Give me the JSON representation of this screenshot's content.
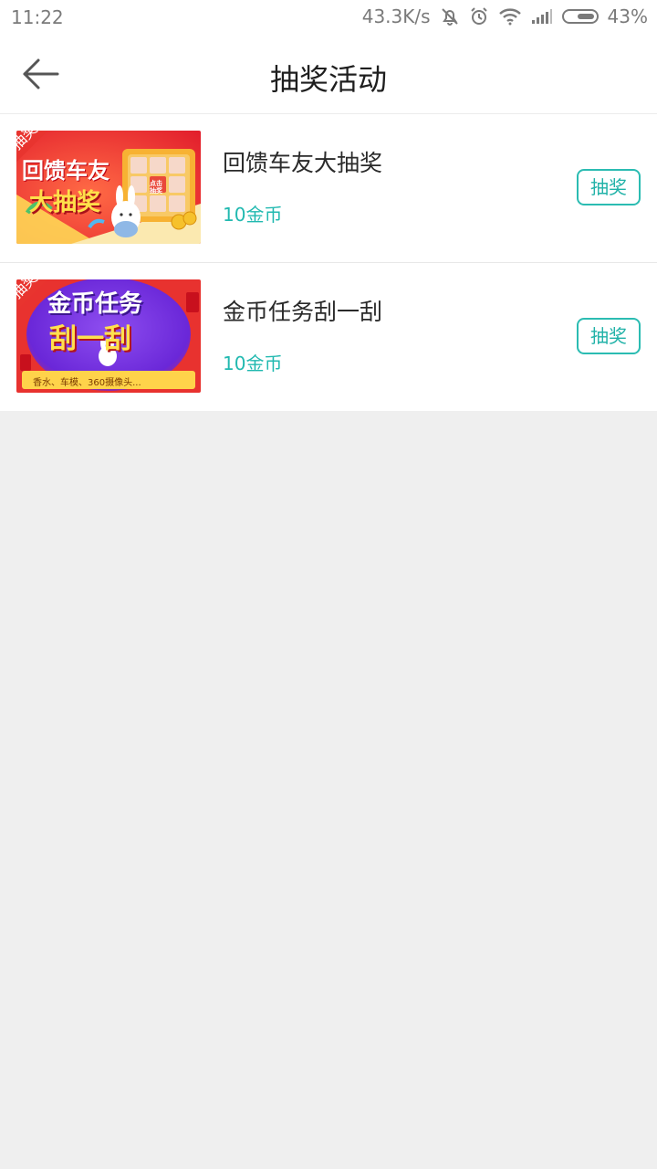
{
  "status": {
    "time": "11:22",
    "speed": "43.3K/s",
    "battery": "43%"
  },
  "header": {
    "title": "抽奖活动",
    "back_icon": "arrow-left-icon"
  },
  "items": [
    {
      "ribbon": "抽奖",
      "name": "回馈车友大抽奖",
      "cost": "10金币",
      "button": "抽奖",
      "banner_line1": "回馈车友",
      "banner_line2": "大抽奖",
      "banner_tag": "点击抽奖"
    },
    {
      "ribbon": "抽奖",
      "name": "金币任务刮一刮",
      "cost": "10金币",
      "button": "抽奖",
      "banner_line1": "金币任务",
      "banner_line2": "刮一刮",
      "banner_sub": "香水、车模、360摄像头..."
    }
  ],
  "colors": {
    "accent": "#21b9b0",
    "ribbon": "#e8342f",
    "background": "#efefef"
  }
}
